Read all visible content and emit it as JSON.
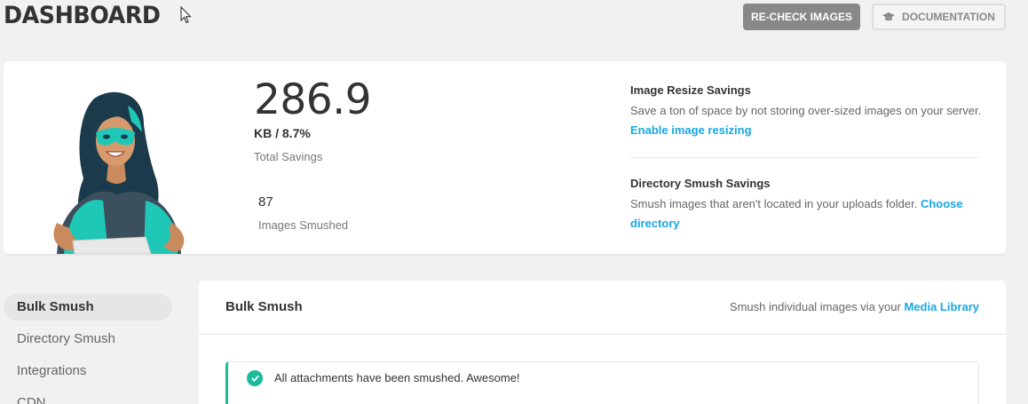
{
  "header": {
    "title": "DASHBOARD",
    "recheck_label": "RE-CHECK IMAGES",
    "docs_label": "DOCUMENTATION"
  },
  "summary": {
    "total_savings_value": "286.9",
    "total_savings_unit": "KB / 8.7%",
    "total_savings_label": "Total Savings",
    "images_smushed_count": "87",
    "images_smushed_label": "Images Smushed",
    "resize": {
      "title": "Image Resize Savings",
      "text": "Save a ton of space by not storing over-sized images on your server.",
      "link": "Enable image resizing"
    },
    "directory": {
      "title": "Directory Smush Savings",
      "text": "Smush images that aren't located in your uploads folder.",
      "link": "Choose directory"
    }
  },
  "sidebar": {
    "items": [
      {
        "label": "Bulk Smush",
        "active": true
      },
      {
        "label": "Directory Smush",
        "active": false
      },
      {
        "label": "Integrations",
        "active": false
      },
      {
        "label": "CDN",
        "active": false
      }
    ]
  },
  "main": {
    "title": "Bulk Smush",
    "hint_text": "Smush individual images via your",
    "hint_link": "Media Library",
    "notice": "All attachments have been smushed. Awesome!"
  },
  "colors": {
    "accent": "#17a8e3",
    "success": "#1abc9c",
    "button_gray": "#888888",
    "background": "#f1f1f1"
  }
}
